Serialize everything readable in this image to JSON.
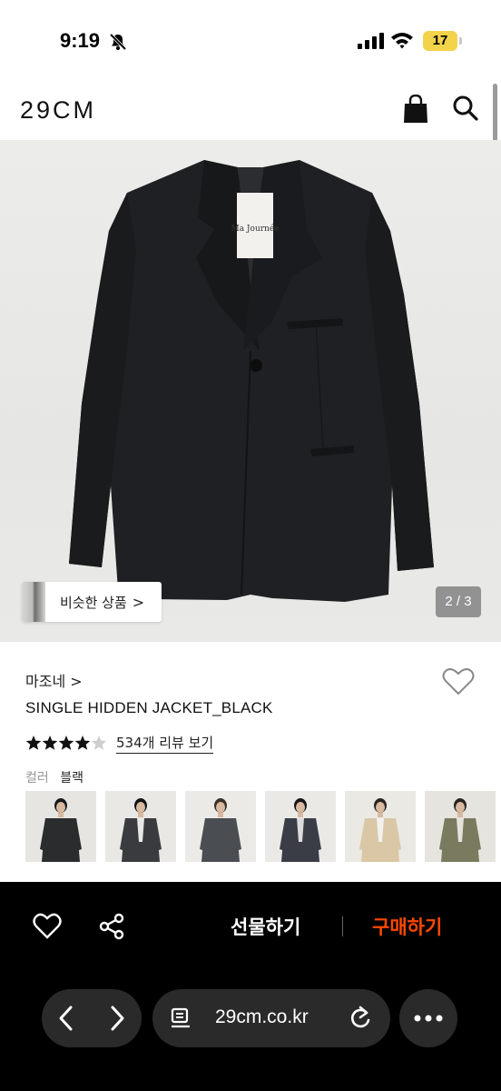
{
  "status_bar": {
    "time": "9:19",
    "battery": "17"
  },
  "header": {
    "logo": "29CM"
  },
  "gallery": {
    "similar_label": "비슷한 상품",
    "similar_chevron": ">",
    "pager": "2 / 3",
    "tag_text": "Ma Journée"
  },
  "product": {
    "brand": "마조네 >",
    "name": "SINGLE HIDDEN JACKET_BLACK",
    "rating": 4.5,
    "review_link": "534개 리뷰 보기",
    "color_label": "컬러",
    "color_value": "블랙"
  },
  "swatches": [
    {
      "label": "black",
      "jacket": "#2b2c2e",
      "shirt": "#2b2c2e",
      "hair": "#1a1a1a",
      "bg": "#e6e5e2",
      "selected": true
    },
    {
      "label": "charcoal",
      "jacket": "#3a3b3e",
      "shirt": "#e8e8e6",
      "hair": "#141414",
      "bg": "#e9e8e5",
      "selected": false
    },
    {
      "label": "dark-grey",
      "jacket": "#4a4e52",
      "shirt": "#4a4e52",
      "hair": "#3a3028",
      "bg": "#ebeae7",
      "selected": false
    },
    {
      "label": "navy",
      "jacket": "#3a3d46",
      "shirt": "#dcdcdc",
      "hair": "#161616",
      "bg": "#eae9e6",
      "selected": false
    },
    {
      "label": "beige",
      "jacket": "#d9c7a6",
      "shirt": "#f3f1ec",
      "hair": "#2a2320",
      "bg": "#ebe9e4",
      "selected": false
    },
    {
      "label": "khaki",
      "jacket": "#7a7a5e",
      "shirt": "#e4e2da",
      "hair": "#2a241f",
      "bg": "#e6e4de",
      "selected": false
    }
  ],
  "bottom_bar": {
    "gift_label": "선물하기",
    "buy_label": "구매하기",
    "buy_color": "#ff4800"
  },
  "browser": {
    "url": "29cm.co.kr"
  }
}
